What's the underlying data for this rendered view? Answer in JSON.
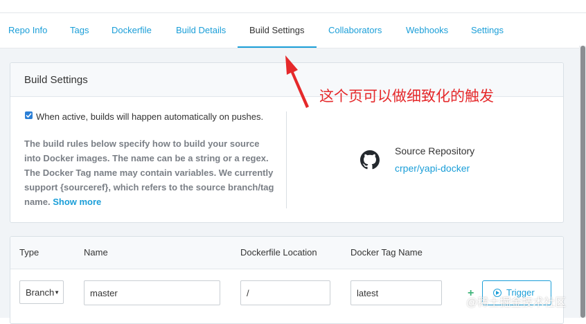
{
  "tabs": [
    {
      "label": "Repo Info"
    },
    {
      "label": "Tags"
    },
    {
      "label": "Dockerfile"
    },
    {
      "label": "Build Details"
    },
    {
      "label": "Build Settings",
      "active": true
    },
    {
      "label": "Collaborators"
    },
    {
      "label": "Webhooks"
    },
    {
      "label": "Settings"
    }
  ],
  "build_settings": {
    "title": "Build Settings",
    "autobuild_checked": true,
    "autobuild_text": "When active, builds will happen automatically on pushes.",
    "rules_text": "The build rules below specify how to build your source into Docker images. The name can be a string or a regex. The Docker Tag name may contain variables. We currently support {sourceref}, which refers to the source branch/tag name.",
    "show_more": "Show more",
    "source_label": "Source Repository",
    "source_repo": "crper/yapi-docker",
    "source_icon": "github-icon"
  },
  "rules_table": {
    "columns": [
      "Type",
      "Name",
      "Dockerfile Location",
      "Docker Tag Name"
    ],
    "row": {
      "type": "Branch",
      "name": "master",
      "dockerfile_location": "/",
      "docker_tag_name": "latest",
      "trigger_label": "Trigger"
    }
  },
  "annotation": "这个页可以做细致化的触发",
  "watermark": "@稀土掘金技术社区",
  "colors": {
    "accent": "#1a9ed8",
    "annotation": "#e5292b",
    "add": "#3fb47a"
  }
}
